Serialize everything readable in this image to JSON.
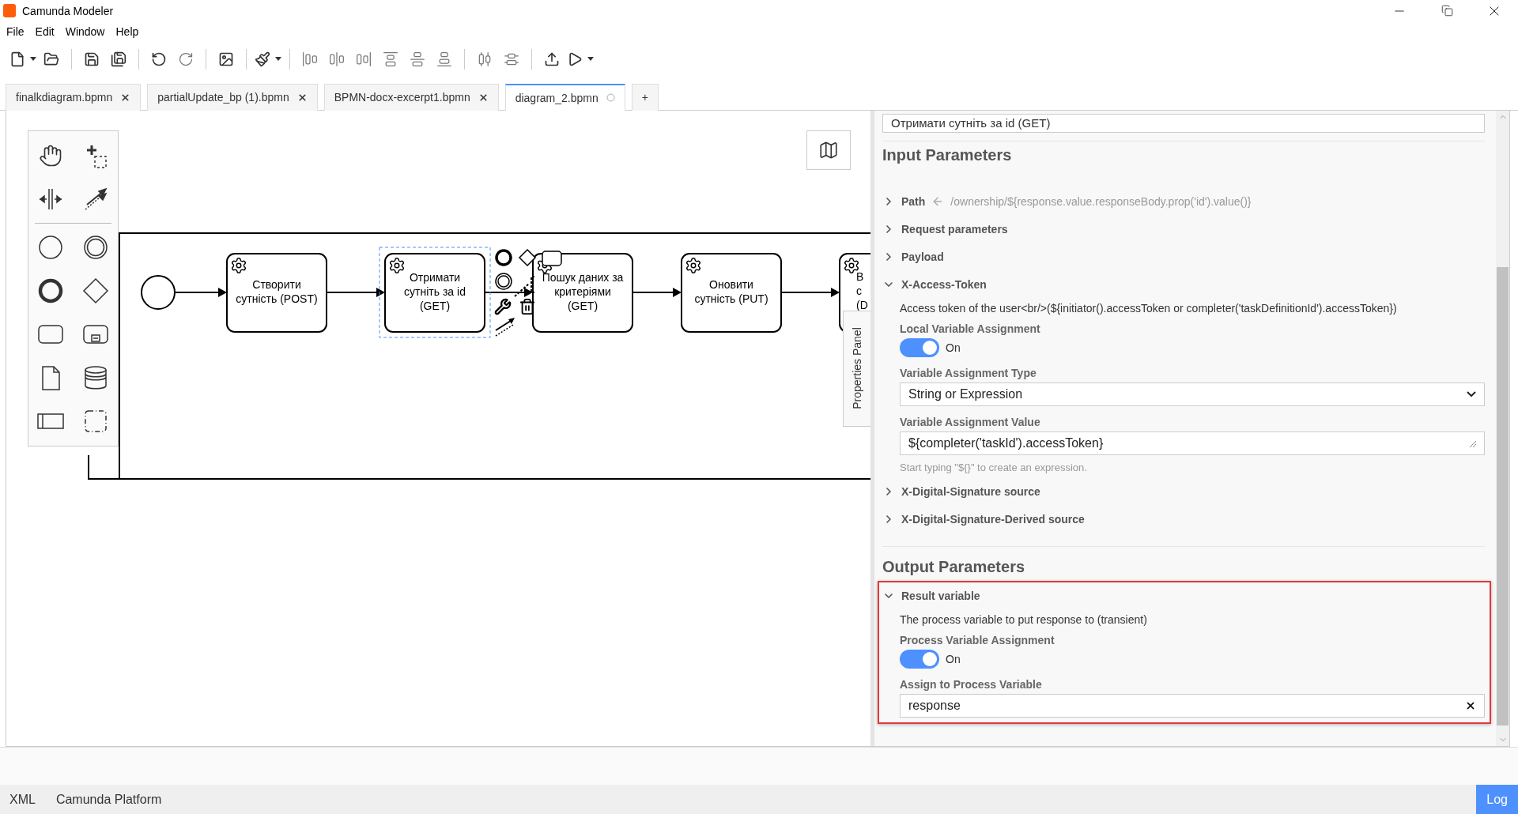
{
  "window": {
    "title": "Camunda Modeler"
  },
  "menu": [
    "File",
    "Edit",
    "Window",
    "Help"
  ],
  "tabs": [
    {
      "label": "finalkdiagram.bpmn",
      "selected": false,
      "unsaved": false
    },
    {
      "label": "partialUpdate_bp (1).bpmn",
      "selected": false,
      "unsaved": false
    },
    {
      "label": "BPMN-docx-excerpt1.bpmn",
      "selected": false,
      "unsaved": false
    },
    {
      "label": "diagram_2.bpmn",
      "selected": true,
      "unsaved": true
    }
  ],
  "new_tab": "+",
  "diagram": {
    "tasks": [
      {
        "lines": [
          "Створити",
          "сутність (POST)"
        ],
        "selected": false
      },
      {
        "lines": [
          "Отримати",
          "сутніть за id",
          "(GET)"
        ],
        "selected": true
      },
      {
        "lines": [
          "Пошук даних за",
          "критеріями",
          "(GET)"
        ],
        "selected": false
      },
      {
        "lines": [
          "Оновити",
          "сутність (PUT)"
        ],
        "selected": false
      },
      {
        "lines": [
          "В",
          "с",
          "(D"
        ],
        "selected": false
      }
    ]
  },
  "properties_panel_tab": "Properties Panel",
  "properties": {
    "name_value": "Отримати сутніть за id (GET)",
    "sections": [
      {
        "title": "Input Parameters",
        "highlighted": false,
        "entries": [
          {
            "title": "Path",
            "expanded": false,
            "value": "/ownership/${response.value.responseBody.prop('id').value()}"
          },
          {
            "title": "Request parameters",
            "expanded": false
          },
          {
            "title": "Payload",
            "expanded": false
          },
          {
            "title": "X-Access-Token",
            "expanded": true,
            "description": "Access token of the user<br/>(${initiator().accessToken or completer('taskDefinitionId').accessToken})",
            "fields": [
              {
                "kind": "toggle",
                "label": "Local Variable Assignment",
                "on": true,
                "text": "On"
              },
              {
                "kind": "select",
                "label": "Variable Assignment Type",
                "value": "String or Expression"
              },
              {
                "kind": "textarea",
                "label": "Variable Assignment Value",
                "value": "${completer('taskId').accessToken}",
                "hint": "Start typing \"${}\" to create an expression."
              }
            ]
          },
          {
            "title": "X-Digital-Signature source",
            "expanded": false
          },
          {
            "title": "X-Digital-Signature-Derived source",
            "expanded": false
          }
        ]
      },
      {
        "title": "Output Parameters",
        "highlighted": true,
        "entries": [
          {
            "title": "Result variable",
            "expanded": true,
            "description": "The process variable to put response to (transient)",
            "fields": [
              {
                "kind": "toggle",
                "label": "Process Variable Assignment",
                "on": true,
                "text": "On"
              },
              {
                "kind": "input",
                "label": "Assign to Process Variable",
                "value": "response",
                "clearable": true
              }
            ]
          }
        ]
      }
    ]
  },
  "status_bar": {
    "items": [
      "XML",
      "Camunda Platform"
    ],
    "log": "Log"
  }
}
